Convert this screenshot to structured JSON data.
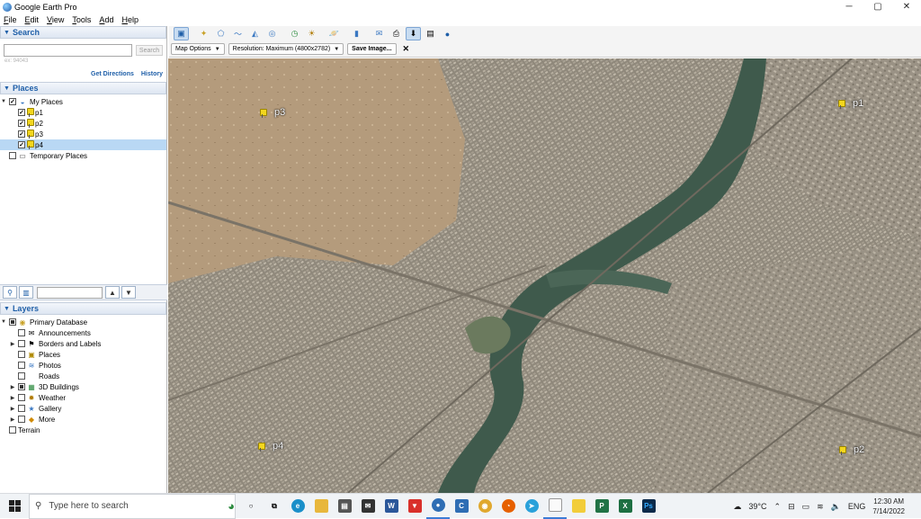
{
  "window": {
    "title": "Google Earth Pro",
    "controls": [
      "─",
      "▢",
      "✕"
    ]
  },
  "menu": [
    "File",
    "Edit",
    "View",
    "Tools",
    "Add",
    "Help"
  ],
  "search": {
    "header": "Search",
    "input_value": "",
    "button_label": "Search",
    "hint": "ex: 94043",
    "get_directions": "Get Directions",
    "history": "History"
  },
  "places": {
    "header": "Places",
    "root": "My Places",
    "items": [
      {
        "label": "p1",
        "checked": true
      },
      {
        "label": "p2",
        "checked": true
      },
      {
        "label": "p3",
        "checked": true
      },
      {
        "label": "p4",
        "checked": true
      }
    ],
    "temporary": "Temporary Places"
  },
  "layers": {
    "header": "Layers",
    "root": "Primary Database",
    "items": [
      {
        "label": "Announcements",
        "icon": "envelope-icon"
      },
      {
        "label": "Borders and Labels",
        "icon": "flag-icon"
      },
      {
        "label": "Places",
        "icon": "places-icon"
      },
      {
        "label": "Photos",
        "icon": "photos-icon"
      },
      {
        "label": "Roads",
        "icon": "none"
      },
      {
        "label": "3D Buildings",
        "icon": "buildings-icon"
      },
      {
        "label": "Weather",
        "icon": "sun-icon"
      },
      {
        "label": "Gallery",
        "icon": "gallery-icon"
      },
      {
        "label": "More",
        "icon": "more-icon"
      }
    ],
    "terrain": "Terrain"
  },
  "print_toolbar": {
    "map_options": "Map Options",
    "resolution": "Resolution: Maximum (4800x2782)",
    "save_image": "Save Image...",
    "close": "✕"
  },
  "placemarks": [
    "p1",
    "p2",
    "p3",
    "p4"
  ],
  "taskbar": {
    "search_placeholder": "Type here to search",
    "weather": "39°C",
    "language": "ENG",
    "time": "12:30 AM",
    "date": "7/14/2022"
  }
}
